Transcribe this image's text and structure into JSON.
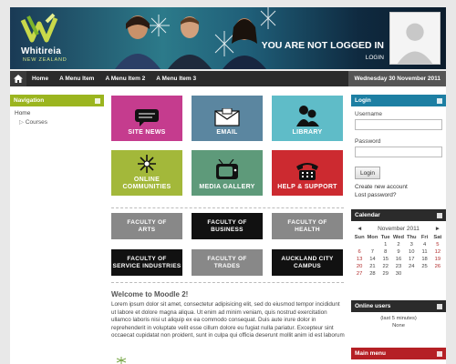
{
  "banner": {
    "logo_name": "Whitireia",
    "logo_sub": "NEW ZEALAND",
    "status_text": "YOU ARE NOT LOGGED IN",
    "login_link": "LOGIN"
  },
  "nav": {
    "items": [
      "Home",
      "A Menu Item",
      "A Menu Item 2",
      "A Menu Item 3"
    ],
    "date": "Wednesday 30 November 2011"
  },
  "navigation_block": {
    "title": "Navigation",
    "home": "Home",
    "courses": "Courses"
  },
  "tiles": [
    {
      "label": "SITE NEWS",
      "color": "#c53c8e",
      "icon": "chat-bubble-icon"
    },
    {
      "label": "EMAIL",
      "color": "#5b86a0",
      "icon": "mail-icon"
    },
    {
      "label": "LIBRARY",
      "color": "#5fbcc8",
      "icon": "people-icon"
    },
    {
      "label": "ONLINE COMMUNITIES",
      "label_lines": [
        "ONLINE",
        "COMMUNITIES"
      ],
      "color": "#a3b83a",
      "icon": "burst-icon"
    },
    {
      "label": "MEDIA GALLERY",
      "color": "#5e9a7a",
      "icon": "tv-icon"
    },
    {
      "label": "HELP & SUPPORT",
      "color": "#cc2a30",
      "icon": "phone-icon"
    }
  ],
  "faculties": [
    {
      "lines": [
        "FACULTY OF",
        "ARTS"
      ],
      "style": "grey"
    },
    {
      "lines": [
        "FACULTY OF",
        "BUSINESS"
      ],
      "style": "black"
    },
    {
      "lines": [
        "FACULTY OF",
        "HEALTH"
      ],
      "style": "grey"
    },
    {
      "lines": [
        "FACULTY OF",
        "SERVICE INDUSTRIES"
      ],
      "style": "black"
    },
    {
      "lines": [
        "FACULTY OF",
        "TRADES"
      ],
      "style": "grey"
    },
    {
      "lines": [
        "AUCKLAND CITY",
        "CAMPUS"
      ],
      "style": "black"
    }
  ],
  "welcome": {
    "title": "Welcome to Moodle 2!",
    "text": "Lorem ipsum dolor sit amet, consectetur adipisicing elit, sed do eiusmod tempor incididunt ut labore et dolore magna aliqua. Ut enim ad minim veniam, quis nostrud exercitation ullamco laboris nisi ut aliquip ex ea commodo consequat. Duis aute irure dolor in reprehenderit in voluptate velit esse cillum dolore eu fugiat nulla pariatur. Excepteur sint occaecat cupidatat non proident, sunt in culpa qui officia deserunt mollit anim id est laborum"
  },
  "login_block": {
    "title": "Login",
    "username_label": "Username",
    "password_label": "Password",
    "button": "Login",
    "create_account": "Create new account",
    "lost_password": "Lost password?"
  },
  "calendar": {
    "title": "Calendar",
    "month": "November 2011",
    "prev": "◄",
    "next": "►",
    "days": [
      "Sun",
      "Mon",
      "Tue",
      "Wed",
      "Thu",
      "Fri",
      "Sat"
    ],
    "weeks": [
      [
        "",
        "",
        "1",
        "2",
        "3",
        "4",
        "5"
      ],
      [
        "6",
        "7",
        "8",
        "9",
        "10",
        "11",
        "12"
      ],
      [
        "13",
        "14",
        "15",
        "16",
        "17",
        "18",
        "19"
      ],
      [
        "20",
        "21",
        "22",
        "23",
        "24",
        "25",
        "26"
      ],
      [
        "27",
        "28",
        "29",
        "30",
        "",
        "",
        ""
      ]
    ]
  },
  "online_users": {
    "title": "Online users",
    "period": "(last 5 minutes)",
    "none": "None"
  },
  "main_menu": {
    "title": "Main menu"
  },
  "colors": {
    "nav_green": "#9bb51f",
    "login_blue": "#1d7fa3",
    "calendar_dark": "#2b2b2b",
    "main_menu_red": "#b52025"
  }
}
